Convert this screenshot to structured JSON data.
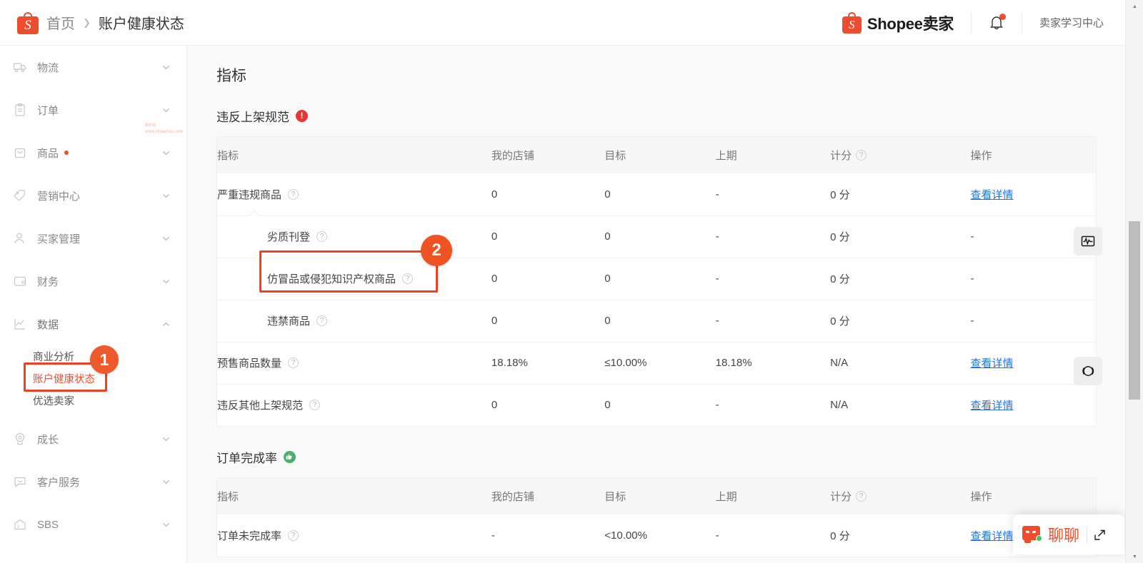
{
  "header": {
    "breadcrumb_home": "首页",
    "breadcrumb_sep": "❯",
    "breadcrumb_current": "账户健康状态",
    "brand_name": "Shopee卖家",
    "learning_center": "卖家学习中心",
    "logo_letter": "S",
    "notification_has_unread": true,
    "accent_color": "#ee4d2d"
  },
  "watermark": {
    "line1": "刷手网",
    "line2": "www.shuashou.com",
    "color": "#f5b3a6"
  },
  "sidebar": {
    "items": [
      {
        "label": "物流",
        "icon": "truck-icon",
        "expanded": false,
        "dot": false
      },
      {
        "label": "订单",
        "icon": "clipboard-icon",
        "expanded": false,
        "dot": false
      },
      {
        "label": "商品",
        "icon": "bag-icon",
        "expanded": false,
        "dot": true
      },
      {
        "label": "营销中心",
        "icon": "tag-icon",
        "expanded": false,
        "dot": false
      },
      {
        "label": "买家管理",
        "icon": "user-icon",
        "expanded": false,
        "dot": false
      },
      {
        "label": "财务",
        "icon": "wallet-icon",
        "expanded": false,
        "dot": false
      },
      {
        "label": "数据",
        "icon": "chart-line-icon",
        "expanded": true,
        "dot": false
      },
      {
        "label": "成长",
        "icon": "medal-icon",
        "expanded": false,
        "dot": false
      },
      {
        "label": "客户服务",
        "icon": "chat-icon",
        "expanded": false,
        "dot": false
      },
      {
        "label": "SBS",
        "icon": "warehouse-icon",
        "expanded": false,
        "dot": false
      }
    ],
    "data_submenu": [
      {
        "label": "商业分析",
        "active": false
      },
      {
        "label": "账户健康状态",
        "active": true
      },
      {
        "label": "优选卖家",
        "active": false
      }
    ]
  },
  "main": {
    "page_heading": "指标",
    "columns": [
      "指标",
      "我的店铺",
      "目标",
      "上期",
      "计分",
      "操作"
    ],
    "score_header_has_tooltip": true,
    "sections": [
      {
        "title": "违反上架规范",
        "status_badge": "alert",
        "rows": [
          {
            "name": "严重违规商品",
            "indent": 0,
            "expander": "down",
            "shop": "0",
            "goal": "0",
            "prev": "-",
            "score": "0 分",
            "action": "查看详情",
            "action_link": true,
            "shop_red": false
          },
          {
            "name": "劣质刊登",
            "indent": 1,
            "expander": "",
            "shop": "0",
            "goal": "0",
            "prev": "-",
            "score": "0 分",
            "action": "-",
            "action_link": false,
            "shop_red": false
          },
          {
            "name": "仿冒品或侵犯知识产权商品",
            "indent": 1,
            "expander": "",
            "shop": "0",
            "goal": "0",
            "prev": "-",
            "score": "0 分",
            "action": "-",
            "action_link": false,
            "shop_red": false
          },
          {
            "name": "违禁商品",
            "indent": 1,
            "expander": "",
            "shop": "0",
            "goal": "0",
            "prev": "-",
            "score": "0 分",
            "action": "-",
            "action_link": false,
            "shop_red": false
          },
          {
            "name": "预售商品数量",
            "indent": 0,
            "expander": "right",
            "shop": "18.18%",
            "goal": "≤10.00%",
            "prev": "18.18%",
            "score": "N/A",
            "action": "查看详情",
            "action_link": true,
            "shop_red": true
          },
          {
            "name": "违反其他上架规范",
            "indent": 0,
            "expander": "",
            "shop": "0",
            "goal": "0",
            "prev": "-",
            "score": "N/A",
            "action": "查看详情",
            "action_link": true,
            "shop_red": false
          }
        ]
      },
      {
        "title": "订单完成率",
        "status_badge": "good",
        "rows": [
          {
            "name": "订单未完成率",
            "indent": 0,
            "expander": "right",
            "shop": "-",
            "goal": "<10.00%",
            "prev": "-",
            "score": "0 分",
            "action": "查看详情",
            "action_link": true,
            "shop_red": false
          }
        ]
      }
    ]
  },
  "annotations": [
    {
      "number": "1",
      "target": "sidebar-item-account-health"
    },
    {
      "number": "2",
      "target": "row-counterfeit-products"
    }
  ],
  "float_widgets": [
    {
      "icon": "pulse-monitor-icon"
    },
    {
      "icon": "headset-ring-icon"
    }
  ],
  "chat_widget": {
    "label": "聊聊",
    "icon": "chat-robot-icon",
    "expand_icon": "expand-arrow-icon"
  }
}
